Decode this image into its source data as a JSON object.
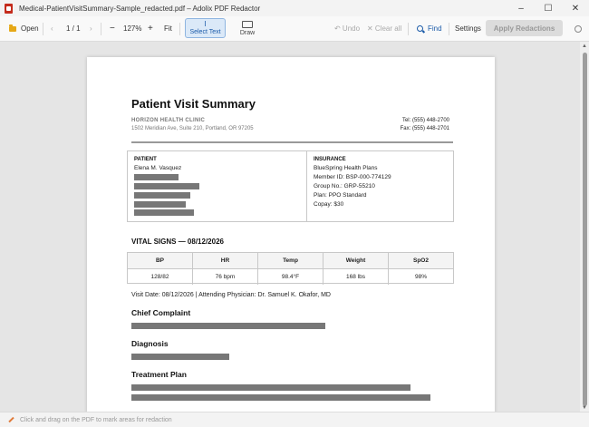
{
  "window": {
    "title": "Medical-PatientVisitSummary-Sample_redacted.pdf – Adolix PDF Redactor",
    "controls": {
      "minimize": "–",
      "maximize": "☐",
      "close": "✕"
    }
  },
  "toolbar": {
    "open_label": "Open",
    "prev_glyph": "‹",
    "page_indicator": "1 / 1",
    "next_glyph": "›",
    "zoom_out": "−",
    "zoom_level": "127%",
    "zoom_in": "+",
    "fit_label": "Fit",
    "select_text_label": "Select Text",
    "select_text_glyph": "I",
    "draw_label": "Draw",
    "undo_label": "↶ Undo",
    "clear_all_label": "✕ Clear all",
    "find_label": "Find",
    "settings_label": "Settings",
    "apply_label": "Apply Redactions"
  },
  "document": {
    "title": "Patient Visit Summary",
    "clinic_name": "HORIZON HEALTH CLINIC",
    "clinic_address": "1502 Meridian Ave, Suite 210, Portland, OR 97205",
    "phone": "Tel: (555) 448-2700",
    "fax": "Fax: (555) 448-2701",
    "patient": {
      "heading": "PATIENT",
      "name": "Elena M. Vasquez"
    },
    "insurance": {
      "heading": "INSURANCE",
      "lines": [
        "BlueSpring Health Plans",
        "Member ID: BSP-000-774129",
        "Group No.: GRP-55210",
        "Plan: PPO Standard",
        "Copay: $30"
      ]
    },
    "vitals": {
      "heading": "VITAL SIGNS — 08/12/2026",
      "headers": [
        "BP",
        "HR",
        "Temp",
        "Weight",
        "SpO2"
      ],
      "values": [
        "128/82",
        "76 bpm",
        "98.4°F",
        "168 lbs",
        "98%"
      ]
    },
    "visit_line": "Visit Date: 08/12/2026   |   Attending Physician: Dr. Samuel K. Okafor, MD",
    "chief_complaint_heading": "Chief Complaint",
    "diagnosis_heading": "Diagnosis",
    "treatment_plan_heading": "Treatment Plan"
  },
  "status": {
    "hint": "Click and drag on the PDF to mark areas for redaction"
  },
  "colors": {
    "accent": "#1a5aa8",
    "redaction": "#777777",
    "app_icon": "#c42b1c"
  }
}
